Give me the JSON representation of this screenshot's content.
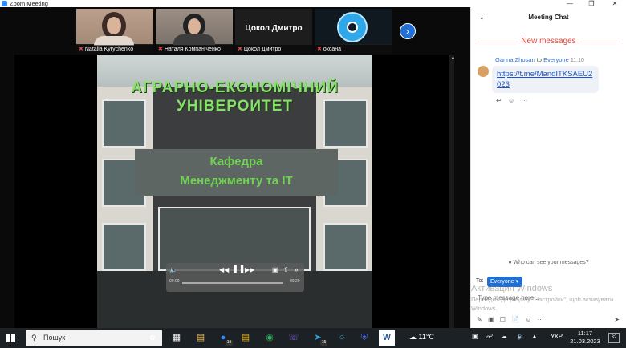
{
  "window": {
    "title": "Zoom Meeting",
    "minimize": "—",
    "maximize": "❐",
    "close": "✕"
  },
  "gallery": {
    "participants": [
      {
        "name": "Natalia Kyrychenko",
        "muted": true
      },
      {
        "name": "Наталя Компаніченко",
        "muted": true
      },
      {
        "name": "Цокол Дмитро",
        "muted": true,
        "video_off": true
      },
      {
        "name": "оксана",
        "muted": true
      }
    ],
    "next_label": "›"
  },
  "video": {
    "heading": "АГРАРНО-ЕКОНОМІЧНИЙ УНІВЕРОИТЕТ",
    "sign_line1": "Кафедра",
    "sign_line2": "Менеджменту та IT",
    "player": {
      "time_elapsed": "00:00",
      "time_total": "00:20",
      "progress": 0.05
    }
  },
  "chat": {
    "title": "Meeting Chat",
    "new_messages": "New messages",
    "message": {
      "sender": "Ganna Zhosan",
      "to_text": "to",
      "recipient": "Everyone",
      "time": "11:10",
      "link": "https://t.me/MandITKSAEU2023"
    },
    "who_can_see": "Who can see your messages?",
    "to_label": "To:",
    "to_value": "Everyone",
    "input_placeholder": "Type message here...",
    "watermark_line1": "Активация Windows",
    "watermark_line2": "Перейдіть до розділу \"Настройки\", щоб активувати Windows."
  },
  "taskbar": {
    "search_label": "Пошук",
    "badges": {
      "zoom": "19",
      "chrome": "",
      "viber": "",
      "telegram": "15"
    },
    "weather": "11°C",
    "language": "УКР",
    "time": "11:17",
    "date": "21.03.2023",
    "notifications": "32"
  },
  "colors": {
    "accent": "#1f6fd4",
    "new_messages": "#e0443a",
    "sign_text": "#6fd250",
    "heading_text": "#88e06c"
  }
}
